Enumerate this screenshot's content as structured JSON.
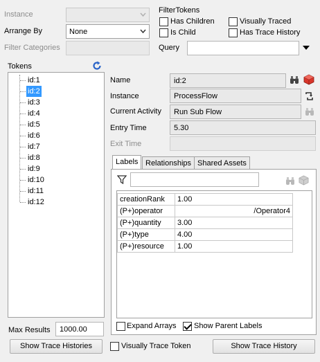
{
  "filters": {
    "instance_label": "Instance",
    "instance_value": "",
    "arrange_by_label": "Arrange By",
    "arrange_by_value": "None",
    "filter_categories_label": "Filter Categories",
    "filter_categories_value": ""
  },
  "filter_tokens": {
    "title": "FilterTokens",
    "has_children": {
      "label": "Has Children",
      "checked": false
    },
    "is_child": {
      "label": "Is Child",
      "checked": false
    },
    "visually_traced": {
      "label": "Visually Traced",
      "checked": false
    },
    "has_trace_history": {
      "label": "Has Trace History",
      "checked": false
    },
    "query_label": "Query",
    "query_value": ""
  },
  "tokens": {
    "title": "Tokens",
    "items": [
      "id:1",
      "id:2",
      "id:3",
      "id:4",
      "id:5",
      "id:6",
      "id:7",
      "id:8",
      "id:9",
      "id:10",
      "id:11",
      "id:12"
    ],
    "selected_index": 1,
    "max_results_label": "Max Results",
    "max_results_value": "1000.00",
    "show_trace_histories_label": "Show Trace Histories"
  },
  "details": {
    "name_label": "Name",
    "name_value": "id:2",
    "instance_label": "Instance",
    "instance_value": "ProcessFlow",
    "current_activity_label": "Current Activity",
    "current_activity_value": "Run Sub Flow",
    "entry_time_label": "Entry Time",
    "entry_time_value": "5.30",
    "exit_time_label": "Exit Time",
    "exit_time_value": ""
  },
  "tabs": [
    {
      "label": "Labels",
      "active": true
    },
    {
      "label": "Relationships",
      "active": false
    },
    {
      "label": "Shared Assets",
      "active": false
    }
  ],
  "labels_table": {
    "filter_value": "",
    "rows": [
      {
        "key": "creationRank",
        "value": "1.00"
      },
      {
        "key": "(P+)operator",
        "value": "/Operator4"
      },
      {
        "key": "(P+)quantity",
        "value": "3.00"
      },
      {
        "key": "(P+)type",
        "value": "4.00"
      },
      {
        "key": "(P+)resource",
        "value": "1.00"
      }
    ],
    "expand_arrays": {
      "label": "Expand Arrays",
      "checked": false
    },
    "show_parent_labels": {
      "label": "Show Parent Labels",
      "checked": true
    }
  },
  "footer": {
    "visually_trace_token": {
      "label": "Visually Trace Token",
      "checked": false
    },
    "show_trace_history_label": "Show Trace History"
  },
  "colors": {
    "selection": "#3399ff",
    "background": "#f0f0f0",
    "refresh_icon": "#2a64c8",
    "cube_icon": "#d9352a"
  },
  "icons": [
    "refresh-icon",
    "binoculars-icon",
    "cube-icon",
    "link-icon",
    "filter-icon",
    "dropdown-arrow-icon"
  ]
}
